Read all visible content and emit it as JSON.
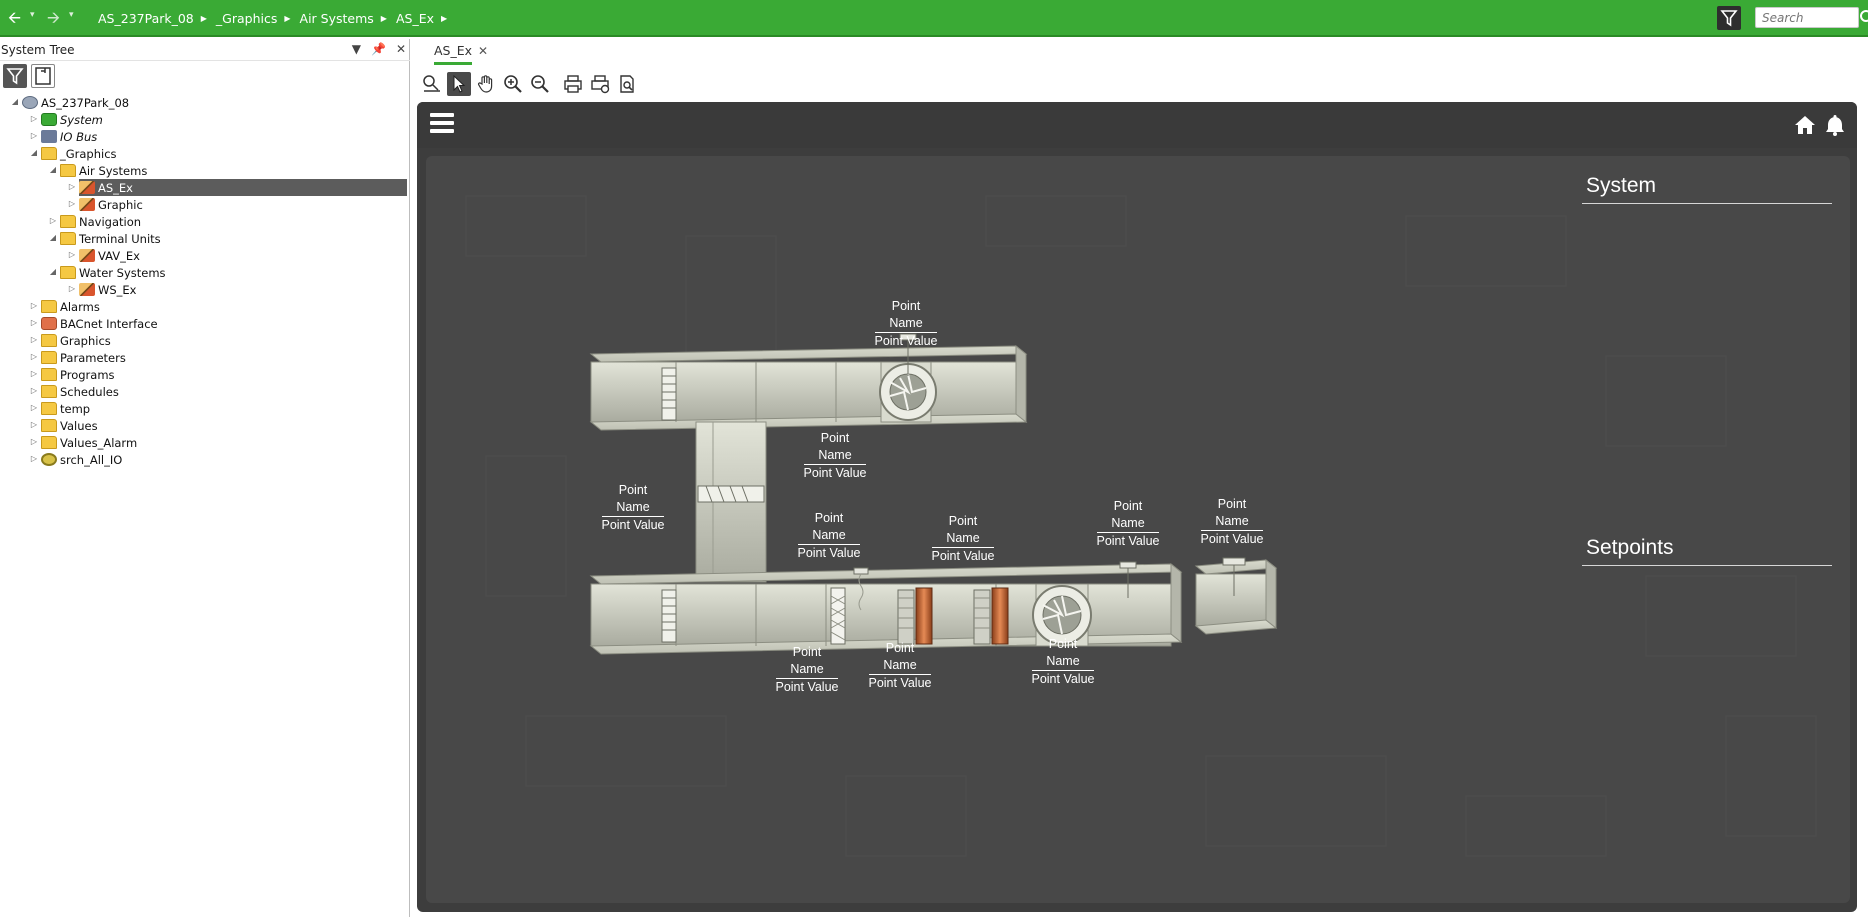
{
  "topbar": {
    "breadcrumb": [
      "AS_237Park_08",
      "_Graphics",
      "Air Systems",
      "AS_Ex"
    ],
    "search_placeholder": "Search"
  },
  "left_panel": {
    "title": "System Tree",
    "tree": [
      {
        "label": "AS_237Park_08",
        "icon": "server-icon",
        "expanded": true
      },
      {
        "label": "System",
        "icon": "gear-icon",
        "italic": true
      },
      {
        "label": "IO Bus",
        "icon": "network-icon",
        "italic": true
      },
      {
        "label": "_Graphics",
        "icon": "folder-icon",
        "expanded": true
      },
      {
        "label": "Air Systems",
        "icon": "folder-icon",
        "expanded": true
      },
      {
        "label": "AS_Ex",
        "icon": "graphic-pen-icon",
        "selected": true
      },
      {
        "label": "Graphic",
        "icon": "graphic-pen-icon"
      },
      {
        "label": "Navigation",
        "icon": "folder-icon"
      },
      {
        "label": "Terminal Units",
        "icon": "folder-icon",
        "expanded": true
      },
      {
        "label": "VAV_Ex",
        "icon": "graphic-pen-icon"
      },
      {
        "label": "Water Systems",
        "icon": "folder-icon",
        "expanded": true
      },
      {
        "label": "WS_Ex",
        "icon": "graphic-pen-icon"
      },
      {
        "label": "Alarms",
        "icon": "folder-icon"
      },
      {
        "label": "BACnet Interface",
        "icon": "bacnet-icon"
      },
      {
        "label": "Graphics",
        "icon": "folder-icon"
      },
      {
        "label": "Parameters",
        "icon": "folder-icon"
      },
      {
        "label": "Programs",
        "icon": "folder-icon"
      },
      {
        "label": "Schedules",
        "icon": "folder-icon"
      },
      {
        "label": "temp",
        "icon": "folder-icon"
      },
      {
        "label": "Values",
        "icon": "folder-icon"
      },
      {
        "label": "Values_Alarm",
        "icon": "folder-icon"
      },
      {
        "label": "srch_All_IO",
        "icon": "search-folder-icon"
      }
    ]
  },
  "content": {
    "tab_label": "AS_Ex",
    "graphic": {
      "section_system": "System",
      "section_setpoints": "Setpoints",
      "point_name": "Point Name",
      "point_value": "Point Value"
    }
  },
  "colors": {
    "brand_green": "#3aaa35",
    "viewer_bg": "#3d3d3d",
    "canvas_bg": "#484848",
    "duct": "#c9cbbf"
  }
}
